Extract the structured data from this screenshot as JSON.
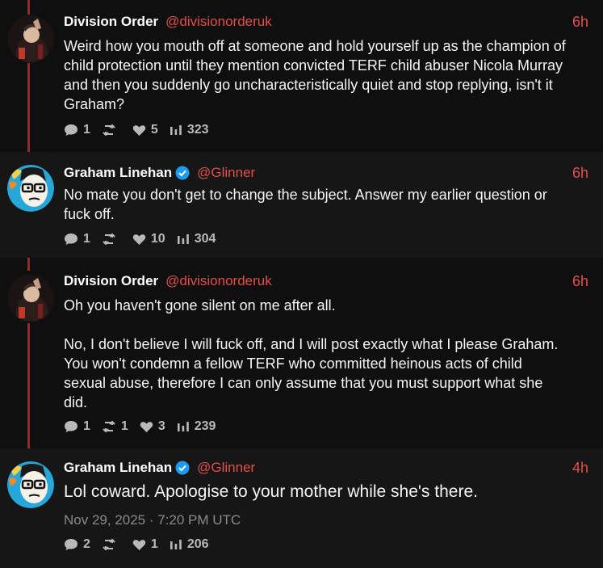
{
  "tweets": [
    {
      "name": "Division Order",
      "handle": "@divisionorderuk",
      "time": "6h",
      "verified": false,
      "text": [
        "Weird how you mouth off at someone and hold yourself up as the champion of",
        "child protection until they mention convicted TERF child abuser Nicola Murray",
        "and then you suddenly go uncharacteristically quiet and stop replying, isn't it",
        "Graham?"
      ],
      "stats": {
        "replies": "1",
        "retweets": "",
        "likes": "5",
        "views": "323"
      }
    },
    {
      "name": "Graham Linehan",
      "handle": "@Glinner",
      "time": "6h",
      "verified": true,
      "text": [
        "No mate you don't get to change the subject. Answer my earlier question or",
        "fuck off."
      ],
      "stats": {
        "replies": "1",
        "retweets": "",
        "likes": "10",
        "views": "304"
      }
    },
    {
      "name": "Division Order",
      "handle": "@divisionorderuk",
      "time": "6h",
      "verified": false,
      "text": [
        "Oh you haven't gone silent on me after all.",
        "No, I don't believe I will fuck off, and I will post exactly what I please Graham.",
        "You won't condemn a fellow TERF who committed heinous acts of child",
        "sexual abuse, therefore I can only assume that you must support what she",
        "did."
      ],
      "stats": {
        "replies": "1",
        "retweets": "1",
        "likes": "3",
        "views": "239"
      }
    },
    {
      "name": "Graham Linehan",
      "handle": "@Glinner",
      "time": "4h",
      "verified": true,
      "text": [
        "Lol coward. Apologise to your mother while she's there."
      ],
      "date": "Nov 29, 2025 · 7:20 PM UTC",
      "stats": {
        "replies": "2",
        "retweets": "",
        "likes": "1",
        "views": "206"
      }
    }
  ],
  "icons": {
    "reply": "speech-bubble-icon",
    "retweet": "retweet-icon",
    "like": "heart-icon",
    "views": "bar-chart-icon",
    "verified": "verified-badge-icon"
  },
  "colors": {
    "background": "#161616",
    "accent": "#e2504a",
    "thread_line": "#8f2c2c",
    "verified": "#1d9bf0",
    "stat_text": "#b9b9b9"
  }
}
